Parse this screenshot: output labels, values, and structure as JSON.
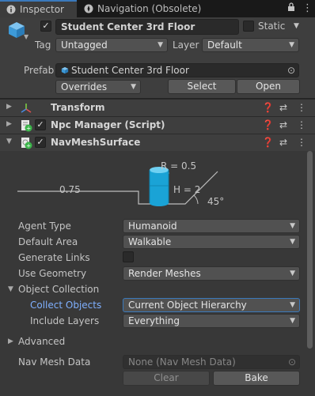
{
  "tabs": {
    "inspector": "Inspector",
    "navigation": "Navigation (Obsolete)"
  },
  "header": {
    "object_name": "Student Center 3rd Floor",
    "static_label": "Static",
    "tag_label": "Tag",
    "tag_value": "Untagged",
    "layer_label": "Layer",
    "layer_value": "Default",
    "prefab_label": "Prefab",
    "prefab_value": "Student Center 3rd Floor",
    "overrides_label": "Overrides",
    "select_button": "Select",
    "open_button": "Open"
  },
  "components": [
    {
      "title": "Transform"
    },
    {
      "title": "Npc Manager (Script)"
    },
    {
      "title": "NavMeshSurface"
    }
  ],
  "agent_diagram": {
    "radius": "R = 0.5",
    "height": "H = 2",
    "step": "0.75",
    "slope": "45°"
  },
  "fields": {
    "agent_type_label": "Agent Type",
    "agent_type_value": "Humanoid",
    "default_area_label": "Default Area",
    "default_area_value": "Walkable",
    "generate_links_label": "Generate Links",
    "use_geometry_label": "Use Geometry",
    "use_geometry_value": "Render Meshes",
    "object_collection_label": "Object Collection",
    "collect_objects_label": "Collect Objects",
    "collect_objects_value": "Current Object Hierarchy",
    "include_layers_label": "Include Layers",
    "include_layers_value": "Everything",
    "advanced_label": "Advanced",
    "nav_mesh_data_label": "Nav Mesh Data",
    "nav_mesh_data_value": "None (Nav Mesh Data)",
    "clear_button": "Clear",
    "bake_button": "Bake"
  },
  "colors": {
    "accent": "#3a79bb",
    "collect_label": "#7fb0ff",
    "cylinder": "#1aa3d6"
  }
}
